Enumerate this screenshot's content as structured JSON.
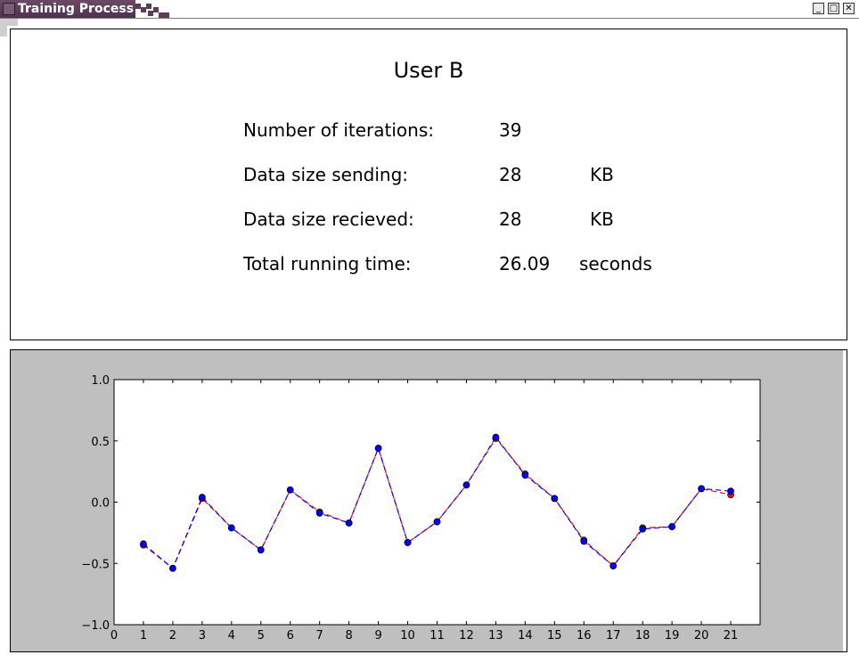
{
  "window": {
    "title": "Training Process",
    "buttons": {
      "minimize": "_",
      "maximize": "□",
      "close": "✕"
    }
  },
  "user_panel": {
    "title": "User B",
    "stats": [
      {
        "label": "Number of iterations:",
        "value": "39",
        "unit": ""
      },
      {
        "label": "Data size sending:",
        "value": "28",
        "unit": "KB"
      },
      {
        "label": "Data size recieved:",
        "value": "28",
        "unit": "KB"
      },
      {
        "label": "Total running time:",
        "value": "26.09",
        "unit": "seconds"
      }
    ]
  },
  "chart_data": {
    "type": "line",
    "title": "",
    "xlabel": "",
    "ylabel": "",
    "xlim": [
      0,
      22
    ],
    "ylim": [
      -1.0,
      1.0
    ],
    "x_ticks": [
      0,
      1,
      2,
      3,
      4,
      5,
      6,
      7,
      8,
      9,
      10,
      11,
      12,
      13,
      14,
      15,
      16,
      17,
      18,
      19,
      20,
      21
    ],
    "y_ticks": [
      -1.0,
      -0.5,
      0.0,
      0.5,
      1.0
    ],
    "y_tick_labels": [
      "−1.0",
      "−0.5",
      "0.0",
      "0.5",
      "1.0"
    ],
    "grid": false,
    "x": [
      1,
      2,
      3,
      4,
      5,
      6,
      7,
      8,
      9,
      10,
      11,
      12,
      13,
      14,
      15,
      16,
      17,
      18,
      19,
      20,
      21
    ],
    "series": [
      {
        "color": "#ff0000",
        "values": [
          -0.35,
          -0.54,
          0.03,
          -0.21,
          -0.39,
          0.1,
          -0.08,
          -0.17,
          0.44,
          -0.33,
          -0.16,
          0.14,
          0.52,
          0.23,
          0.03,
          -0.31,
          -0.52,
          -0.21,
          -0.2,
          0.11,
          0.06
        ]
      },
      {
        "color": "#0000ff",
        "values": [
          -0.34,
          -0.54,
          0.04,
          -0.21,
          -0.39,
          0.1,
          -0.09,
          -0.17,
          0.44,
          -0.33,
          -0.16,
          0.14,
          0.53,
          0.22,
          0.03,
          -0.32,
          -0.52,
          -0.22,
          -0.2,
          0.11,
          0.09
        ]
      }
    ]
  }
}
